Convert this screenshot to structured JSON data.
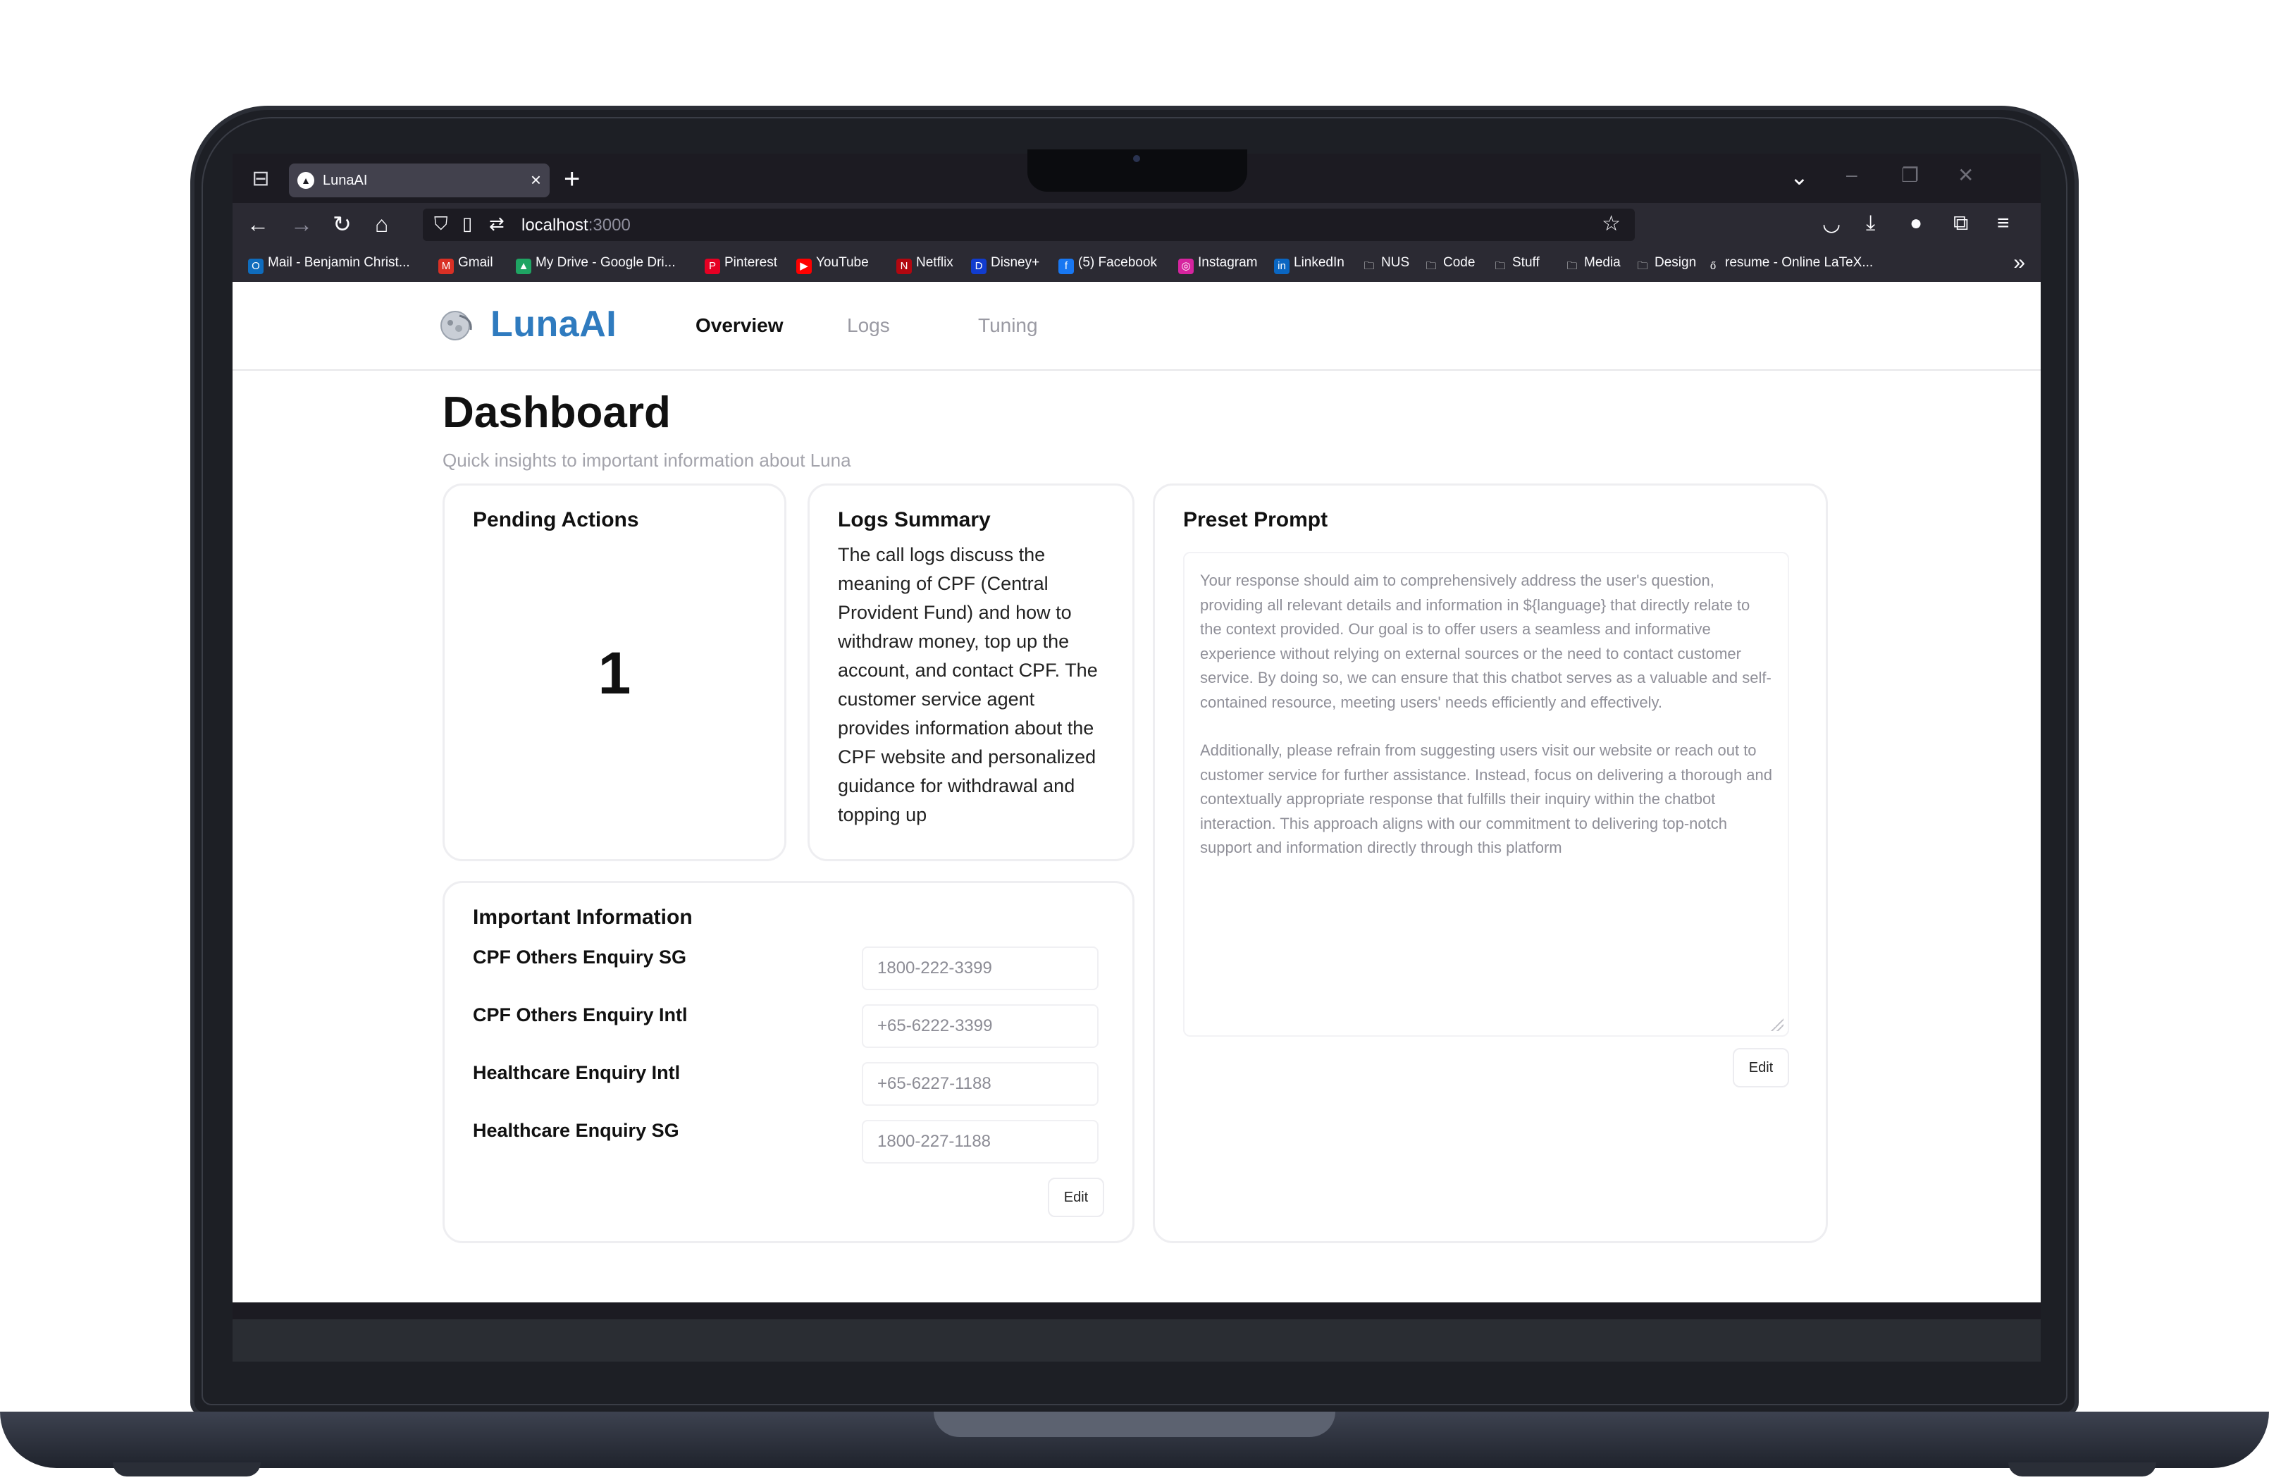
{
  "browser": {
    "tab_title": "LunaAI",
    "url_host": "localhost",
    "url_port": ":3000",
    "bookmarks": [
      {
        "label": "Mail - Benjamin Christ...",
        "icon": "outlook-icon",
        "color": "#0f6cbd",
        "glyph": "O"
      },
      {
        "label": "Gmail",
        "icon": "gmail-icon",
        "color": "#d93025",
        "glyph": "M"
      },
      {
        "label": "My Drive - Google Dri...",
        "icon": "google-drive-icon",
        "color": "#1fa463",
        "glyph": "▲"
      },
      {
        "label": "Pinterest",
        "icon": "pinterest-icon",
        "color": "#e60023",
        "glyph": "P"
      },
      {
        "label": "YouTube",
        "icon": "youtube-icon",
        "color": "#ff0000",
        "glyph": "▶"
      },
      {
        "label": "Netflix",
        "icon": "netflix-icon",
        "color": "#b20710",
        "glyph": "N"
      },
      {
        "label": "Disney+",
        "icon": "disney-icon",
        "color": "#113ccf",
        "glyph": "D"
      },
      {
        "label": "(5) Facebook",
        "icon": "facebook-icon",
        "color": "#1877f2",
        "glyph": "f"
      },
      {
        "label": "Instagram",
        "icon": "instagram-icon",
        "color": "#d6249f",
        "glyph": "◎"
      },
      {
        "label": "LinkedIn",
        "icon": "linkedin-icon",
        "color": "#0a66c2",
        "glyph": "in"
      },
      {
        "label": "NUS",
        "icon": "folder-icon",
        "color": "transparent",
        "glyph": "🗀"
      },
      {
        "label": "Code",
        "icon": "folder-icon",
        "color": "transparent",
        "glyph": "🗀"
      },
      {
        "label": "Stuff",
        "icon": "folder-icon",
        "color": "transparent",
        "glyph": "🗀"
      },
      {
        "label": "Media",
        "icon": "folder-icon",
        "color": "transparent",
        "glyph": "🗀"
      },
      {
        "label": "Design",
        "icon": "folder-icon",
        "color": "transparent",
        "glyph": "🗀"
      },
      {
        "label": "resume - Online LaTeX...",
        "icon": "overleaf-icon",
        "color": "transparent",
        "glyph": "ő"
      }
    ]
  },
  "app": {
    "logo_text": "LunaAI",
    "nav": {
      "overview": "Overview",
      "logs": "Logs",
      "tuning": "Tuning"
    },
    "title": "Dashboard",
    "subtitle": "Quick insights to important information about Luna"
  },
  "pending": {
    "title": "Pending Actions",
    "count": "1"
  },
  "logs_summary": {
    "title": "Logs Summary",
    "text": "The call logs discuss the meaning of CPF (Central Provident Fund) and how to withdraw money, top up the account, and contact CPF. The customer service agent provides information about the CPF website and personalized guidance for withdrawal and topping up"
  },
  "important_info": {
    "title": "Important Information",
    "rows": [
      {
        "label": "CPF Others Enquiry SG",
        "value": "1800-222-3399"
      },
      {
        "label": "CPF Others Enquiry Intl",
        "value": "+65-6222-3399"
      },
      {
        "label": "Healthcare Enquiry Intl",
        "value": "+65-6227-1188"
      },
      {
        "label": "Healthcare Enquiry SG",
        "value": "1800-227-1188"
      }
    ],
    "edit_label": "Edit"
  },
  "preset_prompt": {
    "title": "Preset Prompt",
    "paragraph1": "Your response should aim to comprehensively address the user's question, providing all relevant details and information in ${language} that directly relate to the context provided. Our goal is to offer users a seamless and informative experience without relying on external sources or the need to contact customer service. By doing so, we can ensure that this chatbot serves as a valuable and self-contained resource, meeting users' needs efficiently and effectively.",
    "paragraph2": "Additionally, please refrain from suggesting users visit our website or reach out to customer service for further assistance. Instead, focus on delivering a thorough and contextually appropriate response that fulfills their inquiry within the chatbot interaction. This approach aligns with our commitment to delivering top-notch support and information directly through this platform",
    "edit_label": "Edit"
  },
  "colors": {
    "brand": "#2f7bbf",
    "browser_dark": "#1c1b22",
    "browser_toolbar": "#2b2a33",
    "card_border": "#eeeef1"
  }
}
